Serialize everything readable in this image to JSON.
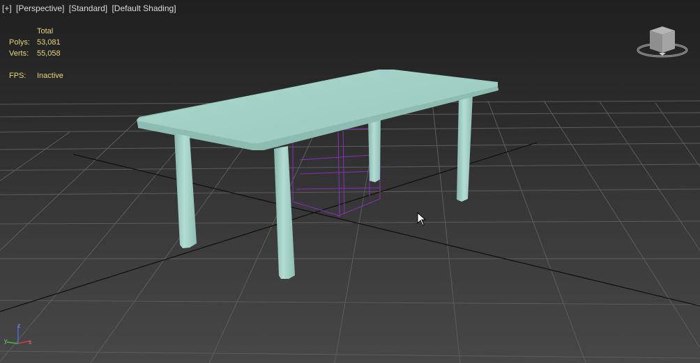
{
  "viewport": {
    "menu": {
      "plus": "[+]",
      "view": "[Perspective]",
      "style": "[Standard]",
      "shading": "[Default Shading]"
    },
    "stats": {
      "header": "Total",
      "polys_label": "Polys:",
      "polys_value": "53,081",
      "verts_label": "Verts:",
      "verts_value": "55,058",
      "fps_label": "FPS:",
      "fps_value": "Inactive"
    },
    "viewcube_icon": "viewcube-icon",
    "axis_labels": {
      "z": "z",
      "y": "y",
      "x": "x"
    },
    "colors": {
      "table": "#a6d6cc",
      "grid": "#5d5d5d",
      "helper_box": "#8a2fbf",
      "stats_text": "#e8d77a"
    }
  }
}
